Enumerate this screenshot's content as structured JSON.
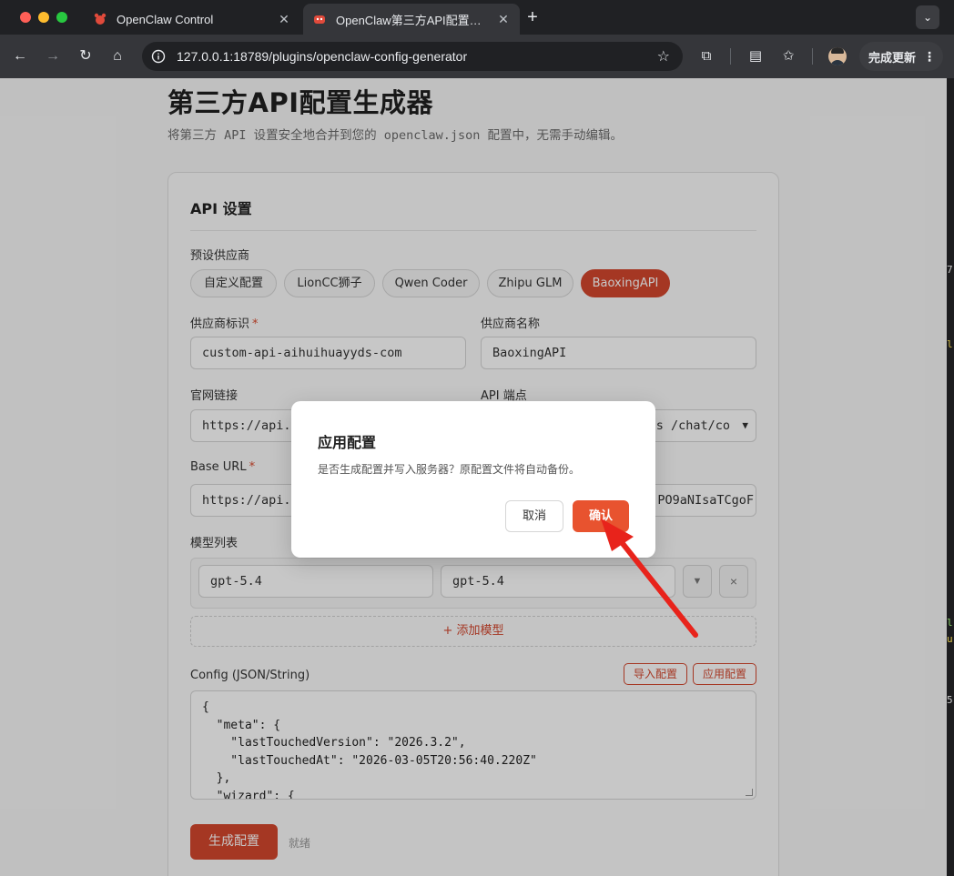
{
  "browser": {
    "tabs": [
      {
        "title": "OpenClaw Control"
      },
      {
        "title": "OpenClaw第三方API配置生成器"
      }
    ],
    "url": "127.0.0.1:18789/plugins/openclaw-config-generator",
    "update_label": "完成更新"
  },
  "page": {
    "title": "第三方API配置生成器",
    "subtitle": "将第三方 API 设置安全地合并到您的 openclaw.json 配置中，无需手动编辑。"
  },
  "card": {
    "title": "API 设置",
    "preset_label": "预设供应商",
    "presets": [
      {
        "label": "自定义配置"
      },
      {
        "label": "LionCC狮子"
      },
      {
        "label": "Qwen Coder"
      },
      {
        "label": "Zhipu GLM"
      },
      {
        "label": "BaoxingAPI"
      }
    ],
    "provider_id_label": "供应商标识",
    "provider_id_value": "custom-api-aihuihuayyds-com",
    "provider_name_label": "供应商名称",
    "provider_name_value": "BaoxingAPI",
    "website_label": "官网链接",
    "website_value": "https://api.",
    "endpoint_label": "API 端点",
    "endpoint_value": "es /chat/co",
    "base_url_label": "Base URL",
    "base_url_value": "https://api.",
    "api_key_visible": "PO9aNIsaTCgoF",
    "models_label": "模型列表",
    "model_id": "gpt-5.4",
    "model_name": "gpt-5.4",
    "model_toggle": "▼",
    "model_remove": "×",
    "add_model": "+ 添加模型",
    "config_label": "Config (JSON/String)",
    "import_btn": "导入配置",
    "apply_btn": "应用配置",
    "config_lines": [
      "{",
      "  \"meta\": {",
      "    \"lastTouchedVersion\": \"2026.3.2\",",
      "    \"lastTouchedAt\": \"2026-03-05T20:56:40.220Z\"",
      "  },",
      "  \"wizard\": {"
    ],
    "generate_btn": "生成配置",
    "status": "就绪"
  },
  "modal": {
    "title": "应用配置",
    "message": "是否生成配置并写入服务器？原配置文件将自动备份。",
    "cancel": "取消",
    "confirm": "确认"
  },
  "colors": {
    "accent": "#d4472e",
    "confirm": "#e8532f",
    "arrow": "#e8231b"
  }
}
